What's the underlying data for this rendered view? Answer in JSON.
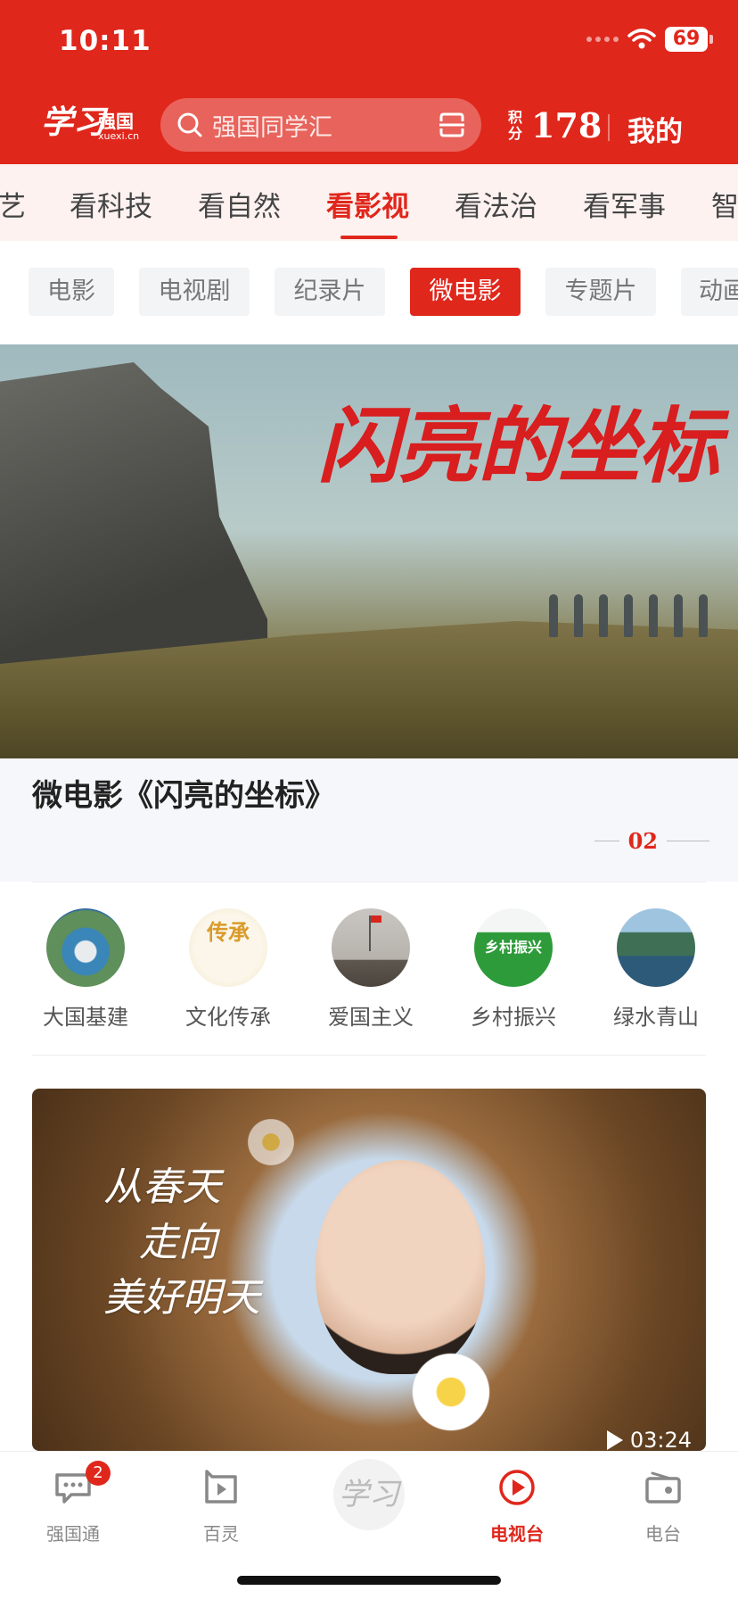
{
  "status": {
    "time": "10:11",
    "battery": "69"
  },
  "header": {
    "logo_script": "学习",
    "logo_name": "强国",
    "logo_url": "xuexi.cn",
    "search_placeholder": "强国同学汇",
    "points_label": "积分",
    "points_value": "178",
    "mine_label": "我的"
  },
  "channels": {
    "items": [
      "艺",
      "看科技",
      "看自然",
      "看影视",
      "看法治",
      "看军事",
      "智"
    ],
    "active": "看影视"
  },
  "subcategories": {
    "items": [
      "电影",
      "电视剧",
      "纪录片",
      "微电影",
      "专题片",
      "动画"
    ],
    "active": "微电影"
  },
  "hero": {
    "banner_text": "闪亮的坐标",
    "caption": "微电影《闪亮的坐标》",
    "page_number": "02"
  },
  "topics": [
    {
      "label": "大国基建",
      "icon": "infrastructure-thumb"
    },
    {
      "label": "文化传承",
      "icon": "culture-thumb",
      "thumb_text": "传承"
    },
    {
      "label": "爱国主义",
      "icon": "patriotism-thumb"
    },
    {
      "label": "乡村振兴",
      "icon": "rural-revival-thumb",
      "thumb_text": "乡村振兴"
    },
    {
      "label": "绿水青山",
      "icon": "green-mountains-thumb"
    }
  ],
  "video": {
    "overlay_text": [
      "从春天",
      "走向",
      "美好明天"
    ],
    "duration": "03:24"
  },
  "tabbar": {
    "items": [
      {
        "label": "强国通",
        "icon": "chat-icon",
        "badge": "2"
      },
      {
        "label": "百灵",
        "icon": "bailing-icon"
      },
      {
        "label": "",
        "icon": "xuexi-center-icon",
        "center_text": "学习"
      },
      {
        "label": "电视台",
        "icon": "tv-play-icon",
        "active": true
      },
      {
        "label": "电台",
        "icon": "radio-icon"
      }
    ]
  },
  "colors": {
    "accent": "#e0271c",
    "chip_bg": "#f3f4f6",
    "tab_inactive": "#888888"
  }
}
